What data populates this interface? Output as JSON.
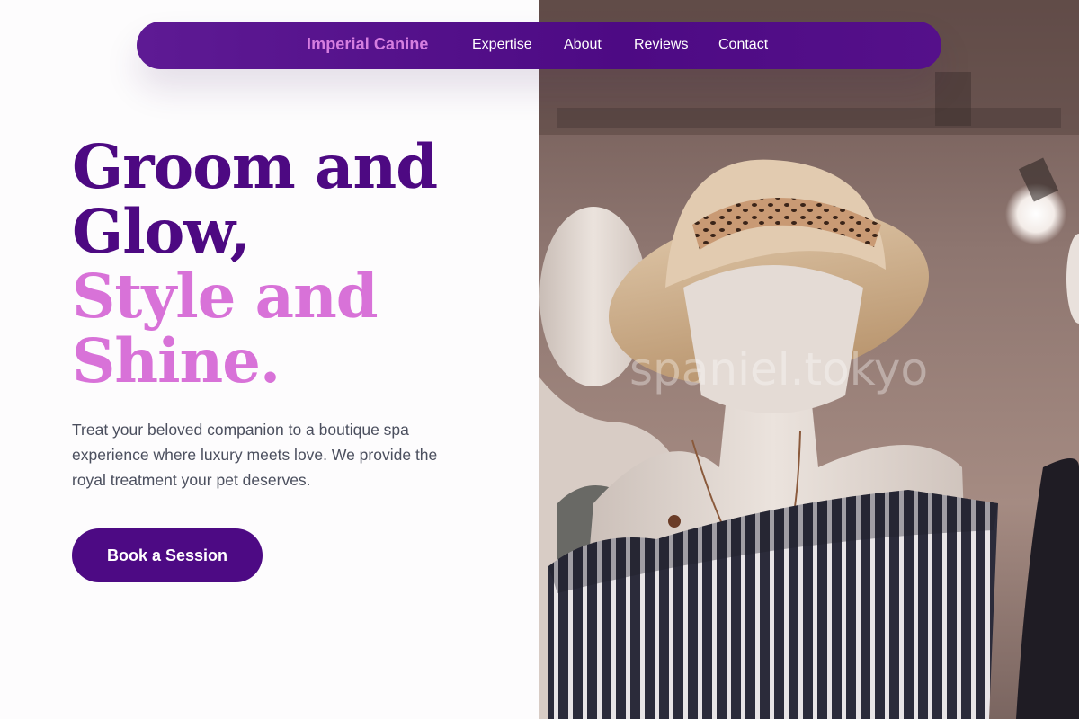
{
  "nav": {
    "brand": "Imperial Canine",
    "links": [
      "Expertise",
      "About",
      "Reviews",
      "Contact"
    ]
  },
  "hero": {
    "headline_line1": "Groom and",
    "headline_line2": "Glow,",
    "headline_line3": "Style and",
    "headline_line4": "Shine.",
    "description": "Treat your beloved companion to a boutique spa experience where luxury meets love. We provide the royal treatment your pet deserves.",
    "cta_label": "Book a Session"
  },
  "image": {
    "watermark": "spaniel.tokyo"
  },
  "colors": {
    "brand_purple": "#4d0a84",
    "accent_pink": "#d872d8",
    "body_text": "#4b4f5e"
  }
}
